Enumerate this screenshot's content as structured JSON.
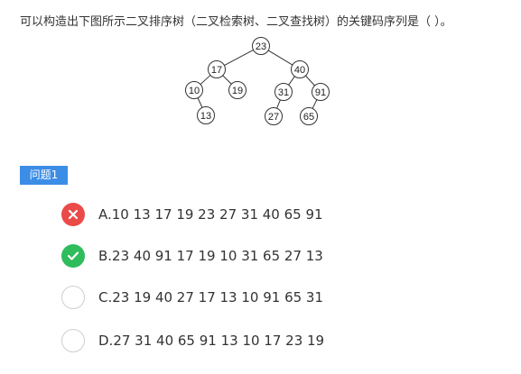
{
  "question": {
    "text": "可以构造出下图所示二叉排序树（二叉检索树、二叉查找树）的关键码序列是（ ）。"
  },
  "tree": {
    "nodes": [
      {
        "id": "n23",
        "label": "23"
      },
      {
        "id": "n17",
        "label": "17"
      },
      {
        "id": "n40",
        "label": "40"
      },
      {
        "id": "n10",
        "label": "10"
      },
      {
        "id": "n19",
        "label": "19"
      },
      {
        "id": "n31",
        "label": "31"
      },
      {
        "id": "n91",
        "label": "91"
      },
      {
        "id": "n13",
        "label": "13"
      },
      {
        "id": "n27",
        "label": "27"
      },
      {
        "id": "n65",
        "label": "65"
      }
    ],
    "edges": [
      [
        "n23",
        "n17"
      ],
      [
        "n23",
        "n40"
      ],
      [
        "n17",
        "n10"
      ],
      [
        "n17",
        "n19"
      ],
      [
        "n40",
        "n31"
      ],
      [
        "n40",
        "n91"
      ],
      [
        "n10",
        "n13"
      ],
      [
        "n31",
        "n27"
      ],
      [
        "n91",
        "n65"
      ]
    ]
  },
  "section": {
    "tag_label": "问题1"
  },
  "options": [
    {
      "text": "A.10 13 17 19 23 27 31 40 65 91",
      "status": "wrong",
      "icon": "cross-icon"
    },
    {
      "text": "B.23 40 91 17 19 10 31 65 27 13",
      "status": "correct",
      "icon": "check-icon"
    },
    {
      "text": "C.23 19 40 27 17 13 10 91 65 31",
      "status": "none",
      "icon": "radio-empty-icon"
    },
    {
      "text": "D.27 31 40 65 91 13 10 17 23 19",
      "status": "none",
      "icon": "radio-empty-icon"
    }
  ],
  "colors": {
    "tag_bg": "#3c8de6",
    "wrong": "#ea4a48",
    "correct": "#2ebc5c"
  }
}
